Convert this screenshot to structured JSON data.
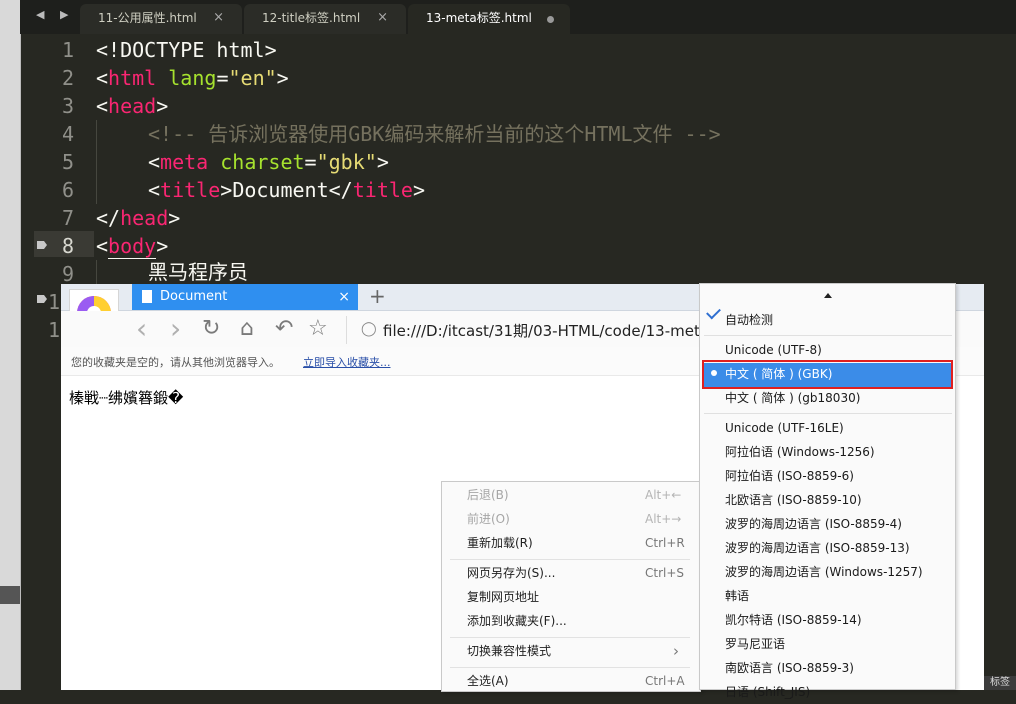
{
  "editor": {
    "tab_nav": "◀ ▶",
    "tabs": [
      {
        "label": "11-公用属性.html",
        "close": "×"
      },
      {
        "label": "12-title标签.html",
        "close": "×"
      },
      {
        "label": "13-meta标签.html",
        "close": ""
      }
    ],
    "line_numbers": [
      "1",
      "2",
      "3",
      "4",
      "5",
      "6",
      "7",
      "8",
      "9",
      "1",
      "1"
    ],
    "lines": {
      "l1": "<!DOCTYPE html>",
      "l2_lt": "<",
      "l2_tag": "html",
      "l2_attr": " lang",
      "l2_eq": "=",
      "l2_val": "\"en\"",
      "l2_gt": ">",
      "l3_lt": "<",
      "l3_tag": "head",
      "l3_gt": ">",
      "l4": "<!-- 告诉浏览器使用GBK编码来解析当前的这个HTML文件 -->",
      "l5_lt": "<",
      "l5_tag": "meta",
      "l5_attr": " charset",
      "l5_eq": "=",
      "l5_val": "\"gbk\"",
      "l5_gt": ">",
      "l6_lt": "<",
      "l6_tag": "title",
      "l6_gt": ">",
      "l6_text": "Document",
      "l6_lt2": "</",
      "l6_tag2": "title",
      "l6_gt2": ">",
      "l7_lt": "</",
      "l7_tag": "head",
      "l7_gt": ">",
      "l8_lt": "<",
      "l8_tag": "body",
      "l8_gt": ">",
      "l9": "黑马程序员"
    }
  },
  "browser": {
    "tab_title": "Document",
    "tab_close": "×",
    "new_tab": "+",
    "nav": {
      "back": "‹",
      "forward": "›",
      "reload": "↻",
      "home": "⌂",
      "undo": "↶",
      "star": "☆"
    },
    "url": "file:///D:/itcast/31期/03-HTML/code/13-met",
    "favbar_text": "您的收藏夹是空的，请从其他浏览器导入。",
    "favbar_link": "立即导入收藏夹...",
    "page_text": "榛戦┈绋嬪簭鍛�"
  },
  "context_menu": {
    "items": [
      {
        "label": "后退(B)",
        "shortcut": "Alt+←"
      },
      {
        "label": "前进(O)",
        "shortcut": "Alt+→"
      },
      {
        "label": "重新加载(R)",
        "shortcut": "Ctrl+R"
      },
      {
        "label": "网页另存为(S)...",
        "shortcut": "Ctrl+S"
      },
      {
        "label": "复制网页地址",
        "shortcut": ""
      },
      {
        "label": "添加到收藏夹(F)...",
        "shortcut": ""
      },
      {
        "label": "切换兼容性模式",
        "shortcut": "›"
      },
      {
        "label": "全选(A)",
        "shortcut": "Ctrl+A"
      }
    ]
  },
  "encoding_menu": {
    "items": [
      "自动检测",
      "Unicode (UTF-8)",
      "中文 ( 简体 ) (GBK)",
      "中文 ( 简体 ) (gb18030)",
      "Unicode (UTF-16LE)",
      "阿拉伯语 (Windows-1256)",
      "阿拉伯语 (ISO-8859-6)",
      "北欧语言 (ISO-8859-10)",
      "波罗的海周边语言 (ISO-8859-4)",
      "波罗的海周边语言 (ISO-8859-13)",
      "波罗的海周边语言 (Windows-1257)",
      "韩语",
      "凯尔特语 (ISO-8859-14)",
      "罗马尼亚语",
      "南欧语言 (ISO-8859-3)",
      "日语 (Shift_JIS)"
    ],
    "selected": "中文 ( 简体 ) (GBK)"
  },
  "status_corner": "标签"
}
